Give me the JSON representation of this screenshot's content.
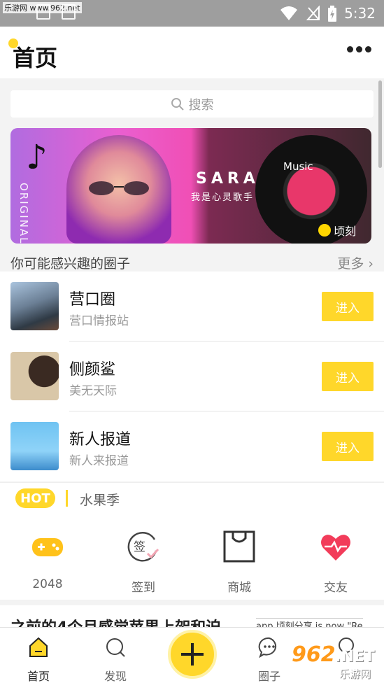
{
  "status_bar": {
    "watermark": "乐游网 www.962.net",
    "time": "5:32"
  },
  "header": {
    "title": "首页"
  },
  "search": {
    "placeholder": "搜索"
  },
  "banner": {
    "side_text": "ORIGINAL",
    "title": "SARA",
    "subtitle": "我是心灵歌手",
    "disc_label": "Music",
    "brand": "顷刻"
  },
  "section": {
    "title": "你可能感兴趣的圈子",
    "more": "更多"
  },
  "circles": [
    {
      "name": "营口圈",
      "desc": "营口情报站",
      "action": "进入"
    },
    {
      "name": "侧颜鲨",
      "desc": "美无天际",
      "action": "进入"
    },
    {
      "name": "新人报道",
      "desc": "新人来报道",
      "action": "进入"
    }
  ],
  "hot": {
    "badge": "HOT",
    "keyword": "水果季"
  },
  "shortcuts": [
    {
      "label": "2048",
      "icon": "gamepad-icon",
      "color": "#ffc21a"
    },
    {
      "label": "签到",
      "icon": "sign-in-icon",
      "color": "#444444"
    },
    {
      "label": "商城",
      "icon": "shop-bag-icon",
      "color": "#333333"
    },
    {
      "label": "交友",
      "icon": "heart-pulse-icon",
      "color": "#f23c5a"
    }
  ],
  "feed": {
    "headline": "之前的4个月感觉苹果上架和迫",
    "side_snippet": "app  顷刻分享  is now \"Re"
  },
  "tabbar": {
    "items": [
      {
        "label": "首页",
        "icon": "home-icon"
      },
      {
        "label": "发现",
        "icon": "discover-icon"
      },
      {
        "label": "圈子",
        "icon": "chat-bubble-icon"
      }
    ],
    "fab_icon": "plus-icon"
  },
  "site_watermark": {
    "big": "962",
    "suffix": ".NET",
    "small": "乐游网"
  },
  "colors": {
    "accent": "#ffd72a",
    "status_bar": "#9e9e9e",
    "background": "#f3f3f3"
  }
}
